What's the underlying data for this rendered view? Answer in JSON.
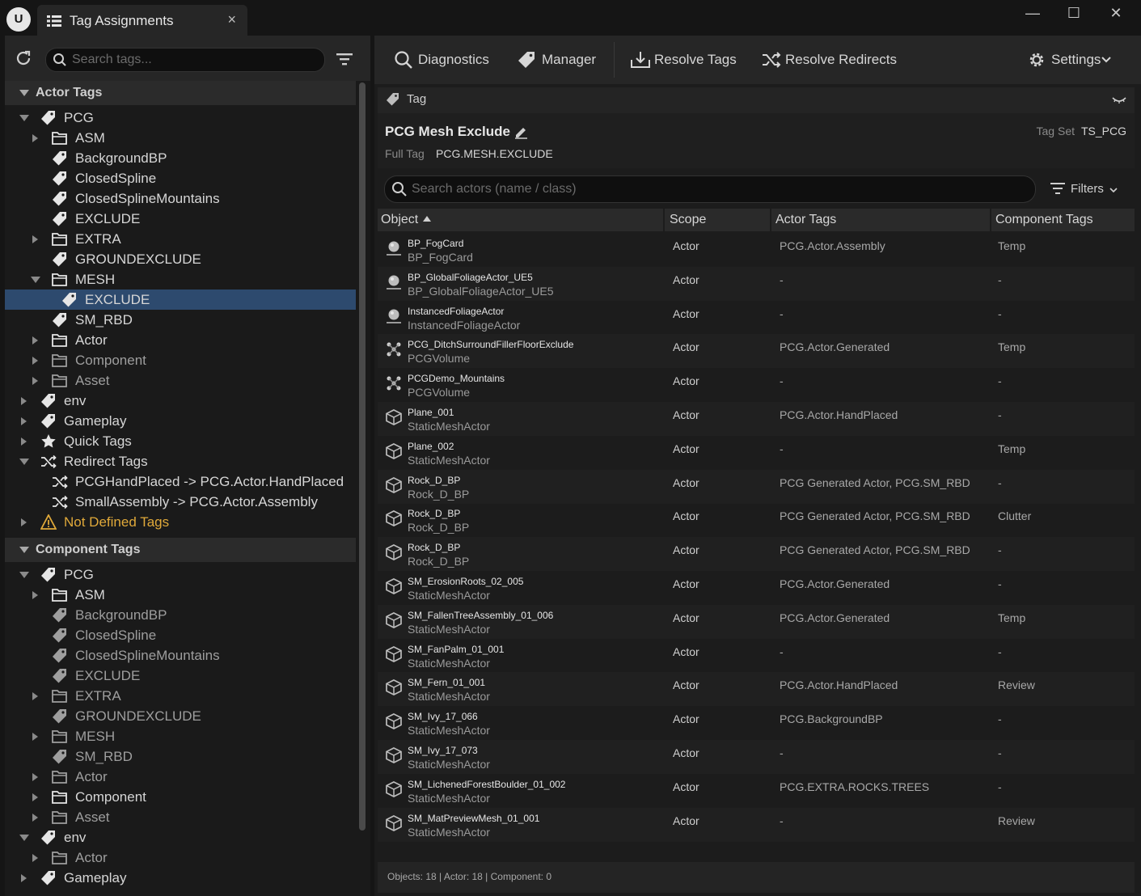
{
  "window": {
    "tab_title": "Tag Assignments",
    "tab_close": "×",
    "logo": "U",
    "min_glyph": "—",
    "max_glyph": "☐",
    "close_glyph": "✕"
  },
  "left": {
    "search_placeholder": "Search tags...",
    "actor_section": "Actor Tags",
    "component_section": "Component Tags",
    "actor_tree": [
      {
        "label": "PCG",
        "icon": "tag-icon",
        "level": 0,
        "expander": "open"
      },
      {
        "label": "ASM",
        "icon": "folder-icon",
        "level": 1,
        "expander": "closed"
      },
      {
        "label": "BackgroundBP",
        "icon": "tag-icon",
        "level": 1
      },
      {
        "label": "ClosedSpline",
        "icon": "tag-icon",
        "level": 1
      },
      {
        "label": "ClosedSplineMountains",
        "icon": "tag-icon",
        "level": 1
      },
      {
        "label": "EXCLUDE",
        "icon": "tag-icon",
        "level": 1
      },
      {
        "label": "EXTRA",
        "icon": "folder-icon",
        "level": 1,
        "expander": "closed"
      },
      {
        "label": "GROUNDEXCLUDE",
        "icon": "tag-icon",
        "level": 1
      },
      {
        "label": "MESH",
        "icon": "folder-icon",
        "level": 1,
        "expander": "open"
      },
      {
        "label": "EXCLUDE",
        "icon": "tag-icon",
        "level": 2,
        "selected": true
      },
      {
        "label": "SM_RBD",
        "icon": "tag-icon",
        "level": 1
      },
      {
        "label": "Actor",
        "icon": "folder-icon",
        "level": 1,
        "expander": "closed"
      },
      {
        "label": "Component",
        "icon": "folder-icon",
        "level": 1,
        "expander": "closed",
        "dim": true
      },
      {
        "label": "Asset",
        "icon": "folder-icon",
        "level": 1,
        "expander": "closed",
        "dim": true
      },
      {
        "label": "env",
        "icon": "tag-icon",
        "level": 0,
        "expander": "closed"
      },
      {
        "label": "Gameplay",
        "icon": "tag-icon",
        "level": 0,
        "expander": "closed"
      },
      {
        "label": "Quick Tags",
        "icon": "star-icon",
        "level": 0,
        "expander": "closed"
      },
      {
        "label": "Redirect Tags",
        "icon": "redirect-icon",
        "level": 0,
        "expander": "open"
      },
      {
        "label": "PCGHandPlaced -> PCG.Actor.HandPlaced",
        "icon": "redirect-icon",
        "level": 1
      },
      {
        "label": "SmallAssembly -> PCG.Actor.Assembly",
        "icon": "redirect-icon",
        "level": 1
      },
      {
        "label": "Not Defined Tags",
        "icon": "warning-icon",
        "level": 0,
        "expander": "closed",
        "warn": true
      }
    ],
    "component_tree": [
      {
        "label": "PCG",
        "icon": "tag-icon",
        "level": 0,
        "expander": "open"
      },
      {
        "label": "ASM",
        "icon": "folder-icon",
        "level": 1,
        "expander": "closed"
      },
      {
        "label": "BackgroundBP",
        "icon": "tag-icon",
        "level": 1,
        "dim": true
      },
      {
        "label": "ClosedSpline",
        "icon": "tag-icon",
        "level": 1,
        "dim": true
      },
      {
        "label": "ClosedSplineMountains",
        "icon": "tag-icon",
        "level": 1,
        "dim": true
      },
      {
        "label": "EXCLUDE",
        "icon": "tag-icon",
        "level": 1,
        "dim": true
      },
      {
        "label": "EXTRA",
        "icon": "folder-icon",
        "level": 1,
        "expander": "closed",
        "dim": true
      },
      {
        "label": "GROUNDEXCLUDE",
        "icon": "tag-icon",
        "level": 1,
        "dim": true
      },
      {
        "label": "MESH",
        "icon": "folder-icon",
        "level": 1,
        "expander": "closed",
        "dim": true
      },
      {
        "label": "SM_RBD",
        "icon": "tag-icon",
        "level": 1,
        "dim": true
      },
      {
        "label": "Actor",
        "icon": "folder-icon",
        "level": 1,
        "expander": "closed",
        "dim": true
      },
      {
        "label": "Component",
        "icon": "folder-icon",
        "level": 1,
        "expander": "closed"
      },
      {
        "label": "Asset",
        "icon": "folder-icon",
        "level": 1,
        "expander": "closed",
        "dim": true
      },
      {
        "label": "env",
        "icon": "tag-icon",
        "level": 0,
        "expander": "open"
      },
      {
        "label": "Actor",
        "icon": "folder-icon",
        "level": 1,
        "expander": "closed",
        "dim": true
      },
      {
        "label": "Gameplay",
        "icon": "tag-icon",
        "level": 0,
        "expander": "closed"
      }
    ]
  },
  "toolbar": {
    "diagnostics": "Diagnostics",
    "manager": "Manager",
    "resolve_tags": "Resolve Tags",
    "resolve_redirects": "Resolve Redirects",
    "settings": "Settings"
  },
  "tag_header": "Tag",
  "detail": {
    "title": "PCG Mesh Exclude",
    "tag_set_label": "Tag Set",
    "tag_set_value": "TS_PCG",
    "full_tag_label": "Full Tag",
    "full_tag_value": "PCG.MESH.EXCLUDE"
  },
  "actor_search": {
    "placeholder": "Search actors (name / class)",
    "filters_label": "Filters"
  },
  "table": {
    "headers": {
      "object": "Object",
      "scope": "Scope",
      "actor_tags": "Actor Tags",
      "component_tags": "Component Tags"
    },
    "rows": [
      {
        "name": "BP_FogCard",
        "class": "BP_FogCard",
        "scope": "Actor",
        "actor_tags": "PCG.Actor.Assembly",
        "component_tags": "Temp",
        "icon": "actor-icon"
      },
      {
        "name": "BP_GlobalFoliageActor_UE5",
        "class": "BP_GlobalFoliageActor_UE5",
        "scope": "Actor",
        "actor_tags": "-",
        "component_tags": "-",
        "icon": "actor-icon"
      },
      {
        "name": "InstancedFoliageActor",
        "class": "InstancedFoliageActor",
        "scope": "Actor",
        "actor_tags": "-",
        "component_tags": "-",
        "icon": "actor-icon"
      },
      {
        "name": "PCG_DitchSurroundFillerFloorExclude",
        "class": "PCGVolume",
        "scope": "Actor",
        "actor_tags": "PCG.Actor.Generated",
        "component_tags": "Temp",
        "icon": "pcg-volume-icon"
      },
      {
        "name": "PCGDemo_Mountains",
        "class": "PCGVolume",
        "scope": "Actor",
        "actor_tags": "-",
        "component_tags": "-",
        "icon": "pcg-volume-icon"
      },
      {
        "name": "Plane_001",
        "class": "StaticMeshActor",
        "scope": "Actor",
        "actor_tags": "PCG.Actor.HandPlaced",
        "component_tags": "-",
        "icon": "static-mesh-icon"
      },
      {
        "name": "Plane_002",
        "class": "StaticMeshActor",
        "scope": "Actor",
        "actor_tags": "-",
        "component_tags": "Temp",
        "icon": "static-mesh-icon"
      },
      {
        "name": "Rock_D_BP",
        "class": "Rock_D_BP",
        "scope": "Actor",
        "actor_tags": "PCG Generated Actor, PCG.SM_RBD",
        "component_tags": "-",
        "icon": "static-mesh-icon"
      },
      {
        "name": "Rock_D_BP",
        "class": "Rock_D_BP",
        "scope": "Actor",
        "actor_tags": "PCG Generated Actor, PCG.SM_RBD",
        "component_tags": "Clutter",
        "icon": "static-mesh-icon"
      },
      {
        "name": "Rock_D_BP",
        "class": "Rock_D_BP",
        "scope": "Actor",
        "actor_tags": "PCG Generated Actor, PCG.SM_RBD",
        "component_tags": "-",
        "icon": "static-mesh-icon"
      },
      {
        "name": "SM_ErosionRoots_02_005",
        "class": "StaticMeshActor",
        "scope": "Actor",
        "actor_tags": "PCG.Actor.Generated",
        "component_tags": "-",
        "icon": "static-mesh-icon"
      },
      {
        "name": "SM_FallenTreeAssembly_01_006",
        "class": "StaticMeshActor",
        "scope": "Actor",
        "actor_tags": "PCG.Actor.Generated",
        "component_tags": "Temp",
        "icon": "static-mesh-icon"
      },
      {
        "name": "SM_FanPalm_01_001",
        "class": "StaticMeshActor",
        "scope": "Actor",
        "actor_tags": "-",
        "component_tags": "-",
        "icon": "static-mesh-icon"
      },
      {
        "name": "SM_Fern_01_001",
        "class": "StaticMeshActor",
        "scope": "Actor",
        "actor_tags": "PCG.Actor.HandPlaced",
        "component_tags": "Review",
        "icon": "static-mesh-icon"
      },
      {
        "name": "SM_Ivy_17_066",
        "class": "StaticMeshActor",
        "scope": "Actor",
        "actor_tags": "PCG.BackgroundBP",
        "component_tags": "-",
        "icon": "static-mesh-icon"
      },
      {
        "name": "SM_Ivy_17_073",
        "class": "StaticMeshActor",
        "scope": "Actor",
        "actor_tags": "-",
        "component_tags": "-",
        "icon": "static-mesh-icon"
      },
      {
        "name": "SM_LichenedForestBoulder_01_002",
        "class": "StaticMeshActor",
        "scope": "Actor",
        "actor_tags": "PCG.EXTRA.ROCKS.TREES",
        "component_tags": "-",
        "icon": "static-mesh-icon"
      },
      {
        "name": "SM_MatPreviewMesh_01_001",
        "class": "StaticMeshActor",
        "scope": "Actor",
        "actor_tags": "-",
        "component_tags": "Review",
        "icon": "static-mesh-icon"
      }
    ]
  },
  "status": "Objects: 18  |  Actor: 18  |  Component: 0",
  "colors": {
    "accent_selected": "#2d4a6e",
    "warning": "#e0a93a",
    "panel": "#1c1c1c",
    "toolbar": "#262626"
  }
}
